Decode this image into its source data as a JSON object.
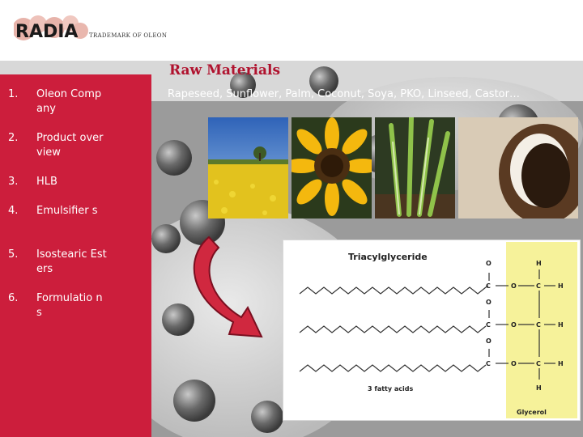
{
  "brand": {
    "logo_text": "RADIA",
    "tagline": "TRADEMARK OF OLEON"
  },
  "nav": {
    "items": [
      {
        "num": "1.",
        "label": "Oleon Company"
      },
      {
        "num": "2.",
        "label": "Product overview"
      },
      {
        "num": "3.",
        "label": "HLB"
      },
      {
        "num": "4.",
        "label": "Emulsifier s"
      },
      {
        "num": "5.",
        "label": "Isostearic Esters"
      },
      {
        "num": "6.",
        "label": "Formulatio ns"
      }
    ]
  },
  "content": {
    "title": "Raw Materials",
    "intro": "Rapeseed, Sunflower, Palm, Coconut, Soya, PKO, Linseed, Castor…"
  },
  "diagram": {
    "title": "Triacylglyceride",
    "fatty_label": "3 fatty acids",
    "glycerol_label": "Glycerol",
    "atom_o": "O",
    "atom_c": "C",
    "atom_h": "H"
  },
  "colors": {
    "accent": "#cc1e3c",
    "title": "#b0122e",
    "glycerol_bg": "#f6f29a"
  }
}
